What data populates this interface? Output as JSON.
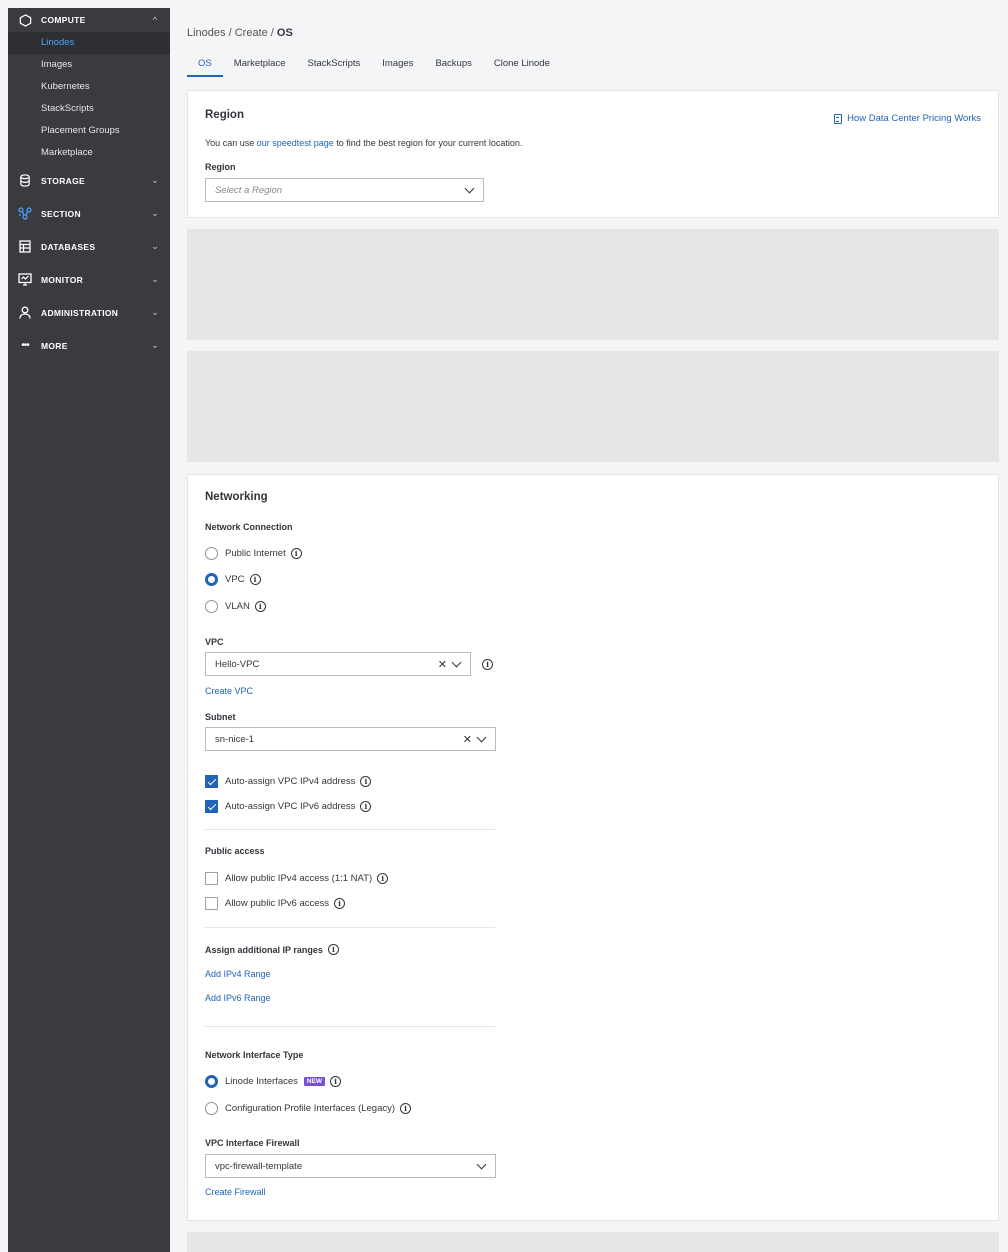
{
  "sidebar": {
    "compute": {
      "label": "COMPUTE",
      "items": [
        "Linodes",
        "Images",
        "Kubernetes",
        "StackScripts",
        "Placement Groups",
        "Marketplace"
      ]
    },
    "groups": [
      "STORAGE",
      "SECTION",
      "DATABASES",
      "MONITOR",
      "ADMINISTRATION",
      "MORE"
    ]
  },
  "breadcrumb": {
    "part1": "Linodes",
    "sep": " / ",
    "part2": "Create",
    "current": "OS"
  },
  "tabs": [
    "OS",
    "Marketplace",
    "StackScripts",
    "Images",
    "Backups",
    "Clone Linode"
  ],
  "region": {
    "title": "Region",
    "pricing_link": "How Data Center Pricing Works",
    "help_prefix": "You can use ",
    "help_link": "our speedtest page",
    "help_suffix": " to find the best region for your current location.",
    "label": "Region",
    "placeholder": "Select a Region"
  },
  "networking": {
    "title": "Networking",
    "connection_label": "Network Connection",
    "options": [
      "Public Internet",
      "VPC",
      "VLAN"
    ],
    "vpc_label": "VPC",
    "vpc_value": "Hello-VPC",
    "create_vpc": "Create VPC",
    "subnet_label": "Subnet",
    "subnet_value": "sn-nice-1",
    "auto_ipv4": "Auto-assign VPC IPv4 address",
    "auto_ipv6": "Auto-assign VPC IPv6 address",
    "public_access_label": "Public access",
    "allow_ipv4": "Allow public IPv4 access (1:1 NAT)",
    "allow_ipv6": "Allow public IPv6 access",
    "ip_ranges_label": "Assign additional IP ranges",
    "add_ipv4": "Add IPv4 Range",
    "add_ipv6": "Add IPv6 Range",
    "iface_type_label": "Network Interface Type",
    "iface_linode": "Linode Interfaces",
    "new_badge": "NEW",
    "iface_legacy": "Configuration Profile Interfaces (Legacy)",
    "firewall_label": "VPC Interface Firewall",
    "firewall_value": "vpc-firewall-template",
    "create_firewall": "Create Firewall"
  },
  "colors": {
    "accent": "#1f64b8",
    "sidebar": "#3a3b3f",
    "active_link": "#4da2ff",
    "badge": "#7b50d3"
  }
}
